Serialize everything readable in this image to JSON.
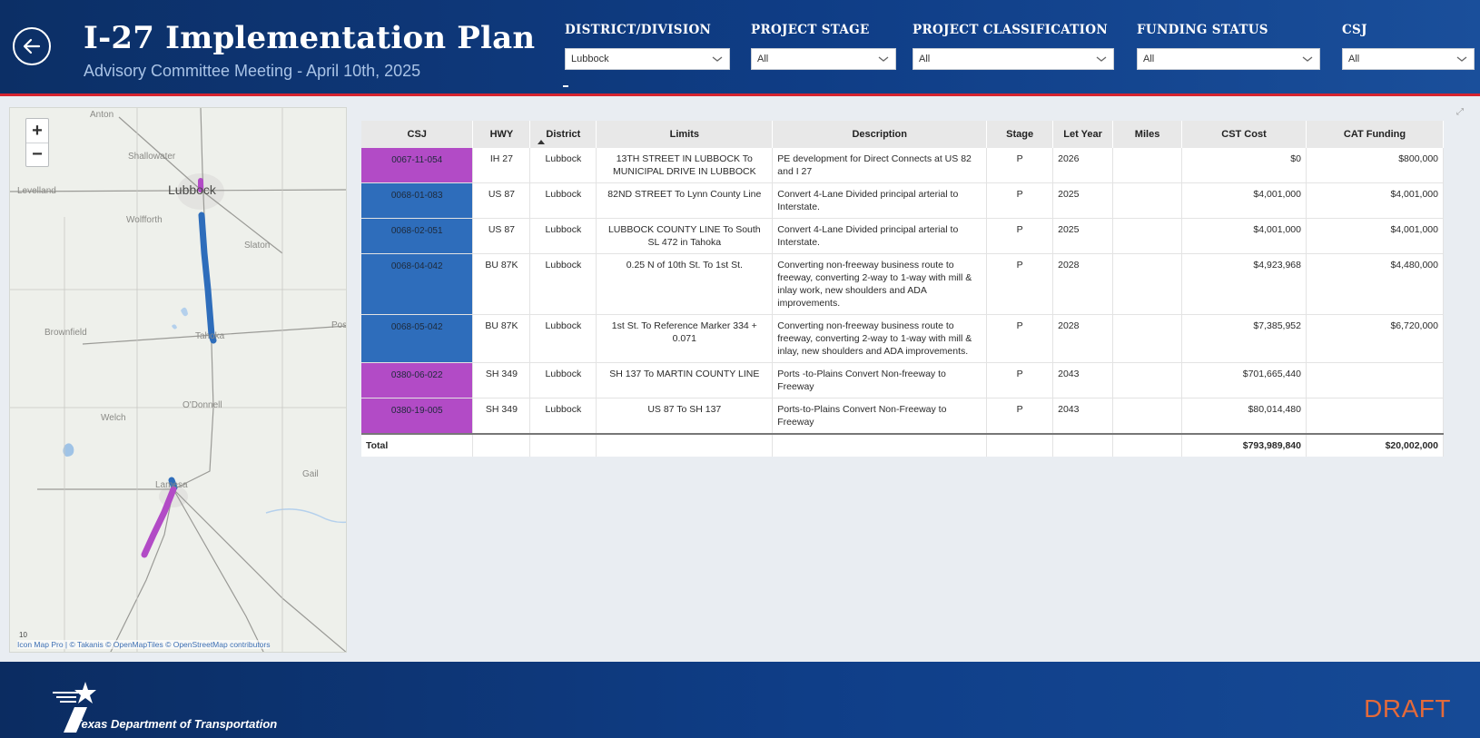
{
  "header": {
    "title": "I-27 Implementation Plan",
    "subtitle": "Advisory Committee Meeting - April 10th, 2025"
  },
  "filters": [
    {
      "label": "DISTRICT/DIVISION",
      "value": "Lubbock"
    },
    {
      "label": "PROJECT STAGE",
      "value": "All"
    },
    {
      "label": "PROJECT CLASSIFICATION",
      "value": "All"
    },
    {
      "label": "FUNDING STATUS",
      "value": "All"
    },
    {
      "label": "CSJ",
      "value": "All"
    }
  ],
  "map": {
    "places": [
      "Anton",
      "Shallowater",
      "Levelland",
      "Lubbock",
      "Wolfforth",
      "Slaton",
      "Brownfield",
      "Tahoka",
      "Pos",
      "O'Donnell",
      "Welch",
      "Lamesa",
      "Gail"
    ],
    "scale": "10",
    "attribution": "Icon Map Pro | © Takanis © OpenMapTiles © OpenStreetMap contributors",
    "colors": {
      "blue": "#2e6dbb",
      "purple": "#b24bc6"
    }
  },
  "table": {
    "headers": [
      "CSJ",
      "HWY",
      "District",
      "Limits",
      "Description",
      "Stage",
      "Let Year",
      "Miles",
      "CST Cost",
      "CAT Funding"
    ],
    "rows": [
      {
        "color": "purple",
        "csj": "0067-11-054",
        "hwy": "IH 27",
        "district": "Lubbock",
        "limits": "13TH STREET IN LUBBOCK To MUNICIPAL DRIVE IN LUBBOCK",
        "description": "PE development for Direct Connects at US 82 and I 27",
        "stage": "P",
        "let_year": "2026",
        "miles": "",
        "cst_cost": "$0",
        "cat_funding": "$800,000"
      },
      {
        "color": "blue",
        "csj": "0068-01-083",
        "hwy": "US 87",
        "district": "Lubbock",
        "limits": "82ND STREET To Lynn County Line",
        "description": "Convert 4-Lane Divided principal arterial to Interstate.",
        "stage": "P",
        "let_year": "2025",
        "miles": "",
        "cst_cost": "$4,001,000",
        "cat_funding": "$4,001,000"
      },
      {
        "color": "blue",
        "csj": "0068-02-051",
        "hwy": "US 87",
        "district": "Lubbock",
        "limits": "LUBBOCK COUNTY LINE To South SL 472 in Tahoka",
        "description": "Convert 4-Lane Divided principal arterial to Interstate.",
        "stage": "P",
        "let_year": "2025",
        "miles": "",
        "cst_cost": "$4,001,000",
        "cat_funding": "$4,001,000"
      },
      {
        "color": "blue",
        "csj": "0068-04-042",
        "hwy": "BU 87K",
        "district": "Lubbock",
        "limits": "0.25 N of 10th St. To 1st St.",
        "description": "Converting non-freeway business route to freeway, converting 2-way to 1-way with mill & inlay work, new shoulders and ADA improvements.",
        "stage": "P",
        "let_year": "2028",
        "miles": "",
        "cst_cost": "$4,923,968",
        "cat_funding": "$4,480,000"
      },
      {
        "color": "blue",
        "csj": "0068-05-042",
        "hwy": "BU 87K",
        "district": "Lubbock",
        "limits": "1st St. To Reference Marker 334 + 0.071",
        "description": "Converting non-freeway business route to freeway, converting 2-way to 1-way with mill & inlay, new shoulders and ADA improvements.",
        "stage": "P",
        "let_year": "2028",
        "miles": "",
        "cst_cost": "$7,385,952",
        "cat_funding": "$6,720,000"
      },
      {
        "color": "purple",
        "csj": "0380-06-022",
        "hwy": "SH 349",
        "district": "Lubbock",
        "limits": "SH 137 To MARTIN COUNTY LINE",
        "description": "Ports -to-Plains Convert Non-freeway to Freeway",
        "stage": "P",
        "let_year": "2043",
        "miles": "",
        "cst_cost": "$701,665,440",
        "cat_funding": ""
      },
      {
        "color": "purple",
        "csj": "0380-19-005",
        "hwy": "SH 349",
        "district": "Lubbock",
        "limits": "US 87 To SH 137",
        "description": "Ports-to-Plains Convert Non-Freeway to Freeway",
        "stage": "P",
        "let_year": "2043",
        "miles": "",
        "cst_cost": "$80,014,480",
        "cat_funding": ""
      }
    ],
    "total": {
      "label": "Total",
      "cst_cost": "$793,989,840",
      "cat_funding": "$20,002,000"
    }
  },
  "footer": {
    "agency": "Texas Department of Transportation",
    "draft": "DRAFT"
  }
}
